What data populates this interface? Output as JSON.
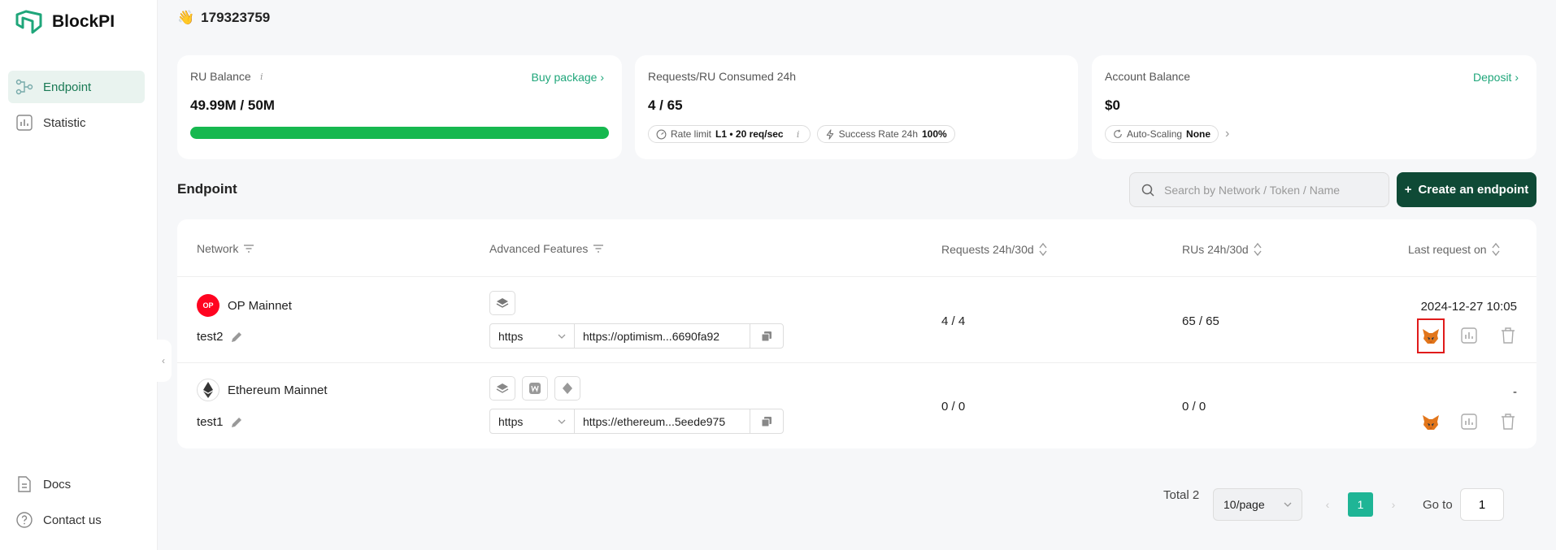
{
  "app": {
    "name": "BlockPI"
  },
  "sidebar": {
    "items": [
      {
        "label": "Endpoint",
        "icon": "endpoint-icon",
        "active": true
      },
      {
        "label": "Statistic",
        "icon": "chart-icon",
        "active": false
      },
      {
        "label": "Docs",
        "icon": "doc-icon",
        "active": false
      },
      {
        "label": "Contact us",
        "icon": "help-icon",
        "active": false
      }
    ]
  },
  "header": {
    "greeting_emoji": "👋",
    "user_id": "179323759"
  },
  "cards": {
    "ru_balance": {
      "title": "RU Balance",
      "link": "Buy package",
      "value": "49.99M / 50M",
      "progress_fraction": 0.9998
    },
    "requests": {
      "title": "Requests/RU Consumed 24h",
      "value": "4 / 65",
      "rate_limit_label": "Rate limit",
      "rate_limit_value": "L1 • 20 req/sec",
      "success_label": "Success Rate 24h",
      "success_value": "100%"
    },
    "account": {
      "title": "Account Balance",
      "link": "Deposit",
      "value": "$0",
      "autoscaling_label": "Auto-Scaling",
      "autoscaling_value": "None"
    }
  },
  "endpoint_section": {
    "title": "Endpoint",
    "search_placeholder": "Search by Network / Token / Name",
    "create_label": "Create an endpoint"
  },
  "table": {
    "headers": {
      "network": "Network",
      "features": "Advanced Features",
      "requests": "Requests 24h/30d",
      "rus": "RUs 24h/30d",
      "last_request": "Last request on"
    },
    "rows": [
      {
        "network": "OP Mainnet",
        "network_badge": "OP",
        "name": "test2",
        "protocol": "https",
        "url": "https://optimism...6690fa92",
        "requests": "4 / 4",
        "rus": "65 / 65",
        "last_request": "2024-12-27 10:05"
      },
      {
        "network": "Ethereum Mainnet",
        "name": "test1",
        "protocol": "https",
        "url": "https://ethereum...5eede975",
        "requests": "0 / 0",
        "rus": "0 / 0",
        "last_request": "-"
      }
    ]
  },
  "pagination": {
    "total": "Total 2",
    "page_size": "10/page",
    "current_page": "1",
    "goto_label": "Go to",
    "goto_value": "1"
  },
  "colors": {
    "accent": "#1fa67a",
    "primary_button": "#0f4a36",
    "progress": "#16b84f",
    "highlight": "#e01b1b"
  }
}
